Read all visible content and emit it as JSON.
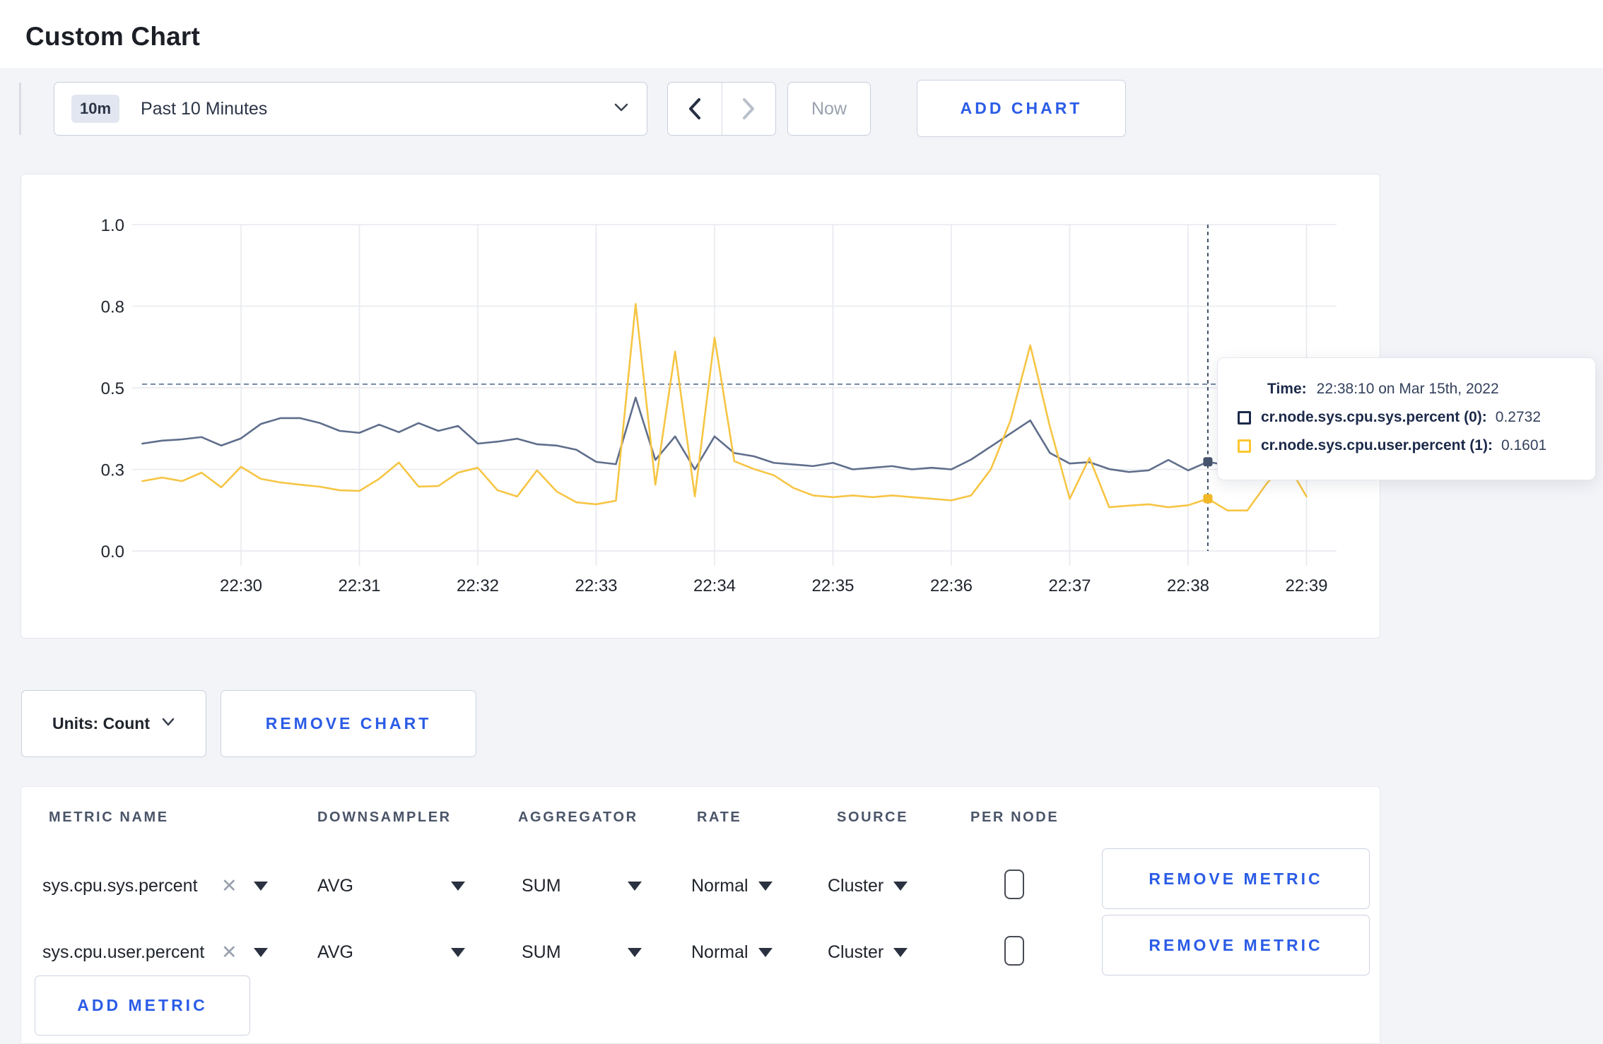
{
  "page": {
    "title": "Custom Chart",
    "accent_blue": "#2b5ce6",
    "background": "#f3f4f8"
  },
  "toolbar": {
    "time_window": {
      "badge": "10m",
      "label": "Past 10 Minutes"
    },
    "now_label": "Now",
    "add_chart_label": "ADD CHART"
  },
  "chart_controls": {
    "units_label": "Units: Count",
    "remove_chart_label": "REMOVE CHART"
  },
  "tooltip": {
    "time_label": "Time:",
    "time_value": "22:38:10 on Mar 15th, 2022",
    "rows": [
      {
        "label": "cr.node.sys.cpu.sys.percent (0):",
        "value": "0.2732",
        "color": "#1c2a4a"
      },
      {
        "label": "cr.node.sys.cpu.user.percent (1):",
        "value": "0.1601",
        "color": "#fdc62e"
      }
    ]
  },
  "chart_data": {
    "type": "line",
    "title": "",
    "xlabel": "",
    "ylabel": "",
    "ylim": [
      0,
      1
    ],
    "grid": true,
    "x_start": "22:29:10",
    "x_interval_seconds": 10,
    "x_tick_labels": [
      "22:30",
      "22:31",
      "22:32",
      "22:33",
      "22:34",
      "22:35",
      "22:36",
      "22:37",
      "22:38",
      "22:39"
    ],
    "y_tick_labels": [
      "1.0",
      "0.8",
      "0.5",
      "0.3",
      "0.0"
    ],
    "y_tick_values": [
      1.0,
      0.75,
      0.5,
      0.25,
      0.0
    ],
    "guide_line_value": 0.511,
    "crosshair": {
      "time": "22:38:10",
      "point_index": 54
    },
    "series": [
      {
        "name": "cr.node.sys.cpu.sys.percent (0)",
        "color": "#5f6e8b",
        "values": [
          0.329,
          0.338,
          0.342,
          0.349,
          0.323,
          0.345,
          0.389,
          0.407,
          0.407,
          0.392,
          0.368,
          0.362,
          0.387,
          0.364,
          0.392,
          0.368,
          0.383,
          0.329,
          0.335,
          0.344,
          0.327,
          0.323,
          0.31,
          0.273,
          0.266,
          0.47,
          0.279,
          0.351,
          0.25,
          0.351,
          0.3,
          0.29,
          0.27,
          0.265,
          0.26,
          0.27,
          0.25,
          0.255,
          0.26,
          0.25,
          0.255,
          0.25,
          0.28,
          0.32,
          0.36,
          0.4,
          0.3,
          0.268,
          0.272,
          0.251,
          0.242,
          0.247,
          0.279,
          0.247,
          0.2732,
          0.262,
          0.27,
          0.268,
          0.27,
          0.27
        ]
      },
      {
        "name": "cr.node.sys.cpu.user.percent (1)",
        "color": "#f6c544",
        "values": [
          0.214,
          0.225,
          0.214,
          0.24,
          0.195,
          0.258,
          0.221,
          0.21,
          0.203,
          0.197,
          0.186,
          0.184,
          0.221,
          0.271,
          0.197,
          0.199,
          0.24,
          0.255,
          0.186,
          0.167,
          0.247,
          0.182,
          0.149,
          0.143,
          0.154,
          0.757,
          0.203,
          0.611,
          0.167,
          0.654,
          0.275,
          0.251,
          0.232,
          0.193,
          0.17,
          0.165,
          0.17,
          0.165,
          0.17,
          0.165,
          0.16,
          0.155,
          0.17,
          0.25,
          0.4,
          0.63,
          0.38,
          0.16,
          0.285,
          0.134,
          0.139,
          0.143,
          0.134,
          0.14,
          0.1601,
          0.124,
          0.124,
          0.208,
          0.27,
          0.167
        ]
      }
    ]
  },
  "metrics_table": {
    "headers": [
      "METRIC NAME",
      "DOWNSAMPLER",
      "AGGREGATOR",
      "RATE",
      "SOURCE",
      "PER NODE"
    ],
    "rows": [
      {
        "metric": "sys.cpu.sys.percent",
        "downsampler": "AVG",
        "aggregator": "SUM",
        "rate": "Normal",
        "source": "Cluster",
        "per_node_checked": false,
        "remove_label": "REMOVE METRIC"
      },
      {
        "metric": "sys.cpu.user.percent",
        "downsampler": "AVG",
        "aggregator": "SUM",
        "rate": "Normal",
        "source": "Cluster",
        "per_node_checked": false,
        "remove_label": "REMOVE METRIC"
      }
    ],
    "add_metric_label": "ADD METRIC"
  }
}
